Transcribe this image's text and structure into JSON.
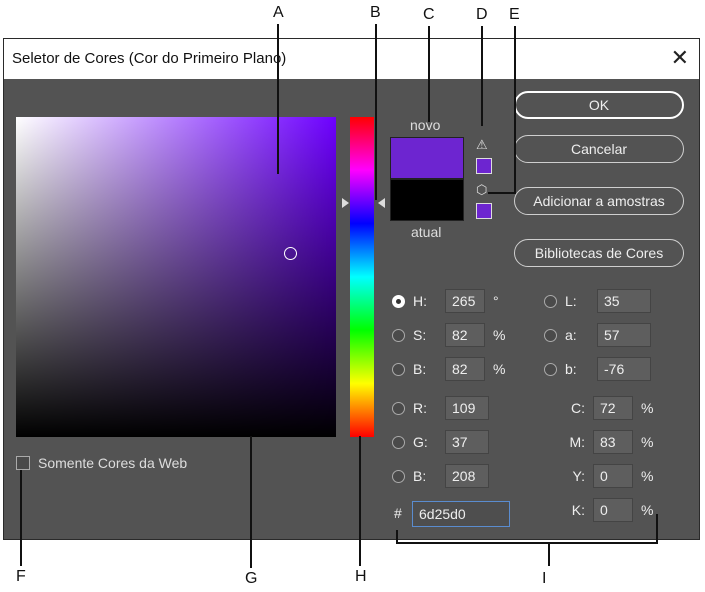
{
  "callouts": {
    "A": "A",
    "B": "B",
    "C": "C",
    "D": "D",
    "E": "E",
    "F": "F",
    "G": "G",
    "H": "H",
    "I": "I"
  },
  "dialog": {
    "title": "Seletor de Cores (Cor do Primeiro Plano)",
    "close_glyph": "✕",
    "new_label": "novo",
    "current_label": "atual",
    "warning_glyph": "⚠",
    "cube_glyph": "⬡",
    "web_only_label": "Somente Cores da Web",
    "buttons": {
      "ok": "OK",
      "cancel": "Cancelar",
      "add_swatch": "Adicionar a amostras",
      "libraries": "Bibliotecas de Cores"
    },
    "hsb": [
      {
        "label": "H:",
        "value": "265",
        "unit": "°"
      },
      {
        "label": "S:",
        "value": "82",
        "unit": "%"
      },
      {
        "label": "B:",
        "value": "82",
        "unit": "%"
      }
    ],
    "rgb": [
      {
        "label": "R:",
        "value": "109"
      },
      {
        "label": "G:",
        "value": "37"
      },
      {
        "label": "B:",
        "value": "208"
      }
    ],
    "lab": [
      {
        "label": "L:",
        "value": "35"
      },
      {
        "label": "a:",
        "value": "57"
      },
      {
        "label": "b:",
        "value": "-76"
      }
    ],
    "cmyk": [
      {
        "label": "C:",
        "value": "72",
        "unit": "%"
      },
      {
        "label": "M:",
        "value": "83",
        "unit": "%"
      },
      {
        "label": "Y:",
        "value": "0",
        "unit": "%"
      },
      {
        "label": "K:",
        "value": "0",
        "unit": "%"
      }
    ],
    "hash": "#",
    "hex": "6d25d0"
  },
  "colors": {
    "new": "#6d25d0",
    "current": "#000000",
    "dialog_bg": "#535353"
  }
}
